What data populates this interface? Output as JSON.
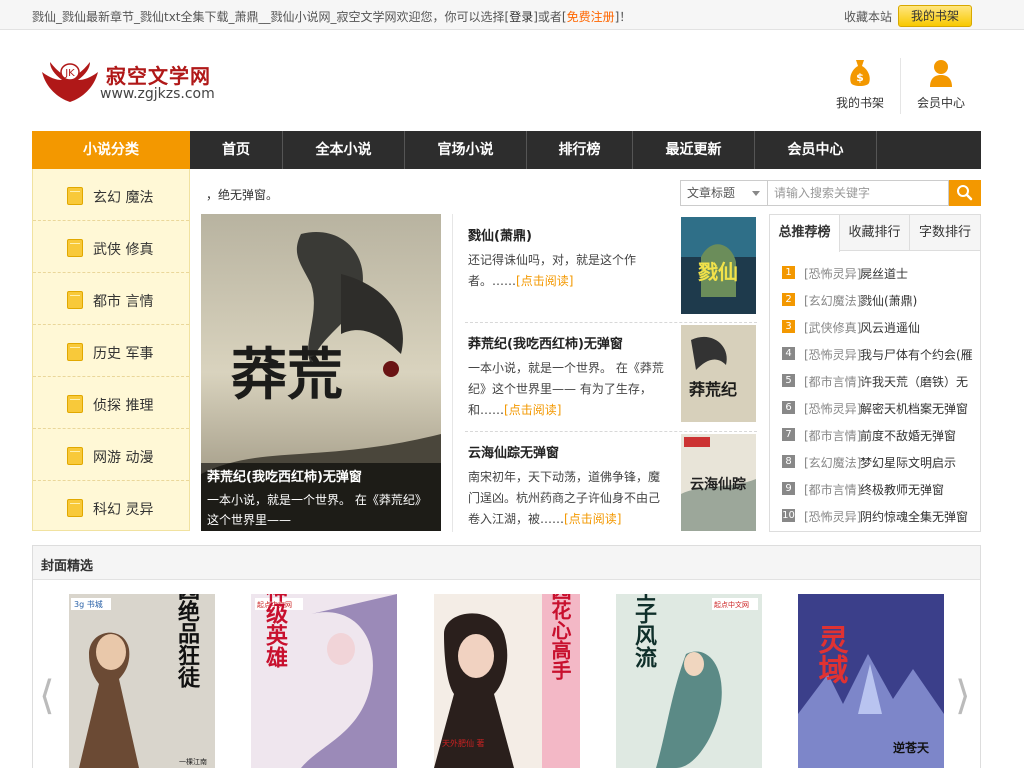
{
  "topbar": {
    "intro_prefix": "戮仙_戮仙最新章节_戮仙txt全集下载_萧鼎__戮仙小说网_寂空文学网欢迎您，你可以选择[",
    "login": "登录",
    "intro_middle": "]或者[",
    "register": "免费注册",
    "intro_suffix": "]！",
    "bookmark": "收藏本站",
    "my_shelf": "我的书架"
  },
  "header": {
    "logo_cn": "寂空文学网",
    "logo_url": "www.zgjkzs.com",
    "logo_badge": "JK",
    "links": [
      {
        "label": "我的书架",
        "icon": "money-bag-icon"
      },
      {
        "label": "会员中心",
        "icon": "user-icon"
      }
    ]
  },
  "nav": {
    "category": "小说分类",
    "items": [
      "首页",
      "全本小说",
      "官场小说",
      "排行榜",
      "最近更新",
      "会员中心"
    ]
  },
  "sidebar": {
    "items": [
      "玄幻 魔法",
      "武侠 修真",
      "都市 言情",
      "历史 军事",
      "侦探 推理",
      "网游 动漫",
      "科幻 灵异"
    ]
  },
  "notice": "，绝无弹窗。",
  "featured": {
    "title": "莽荒纪(我吃西红柿)无弹窗",
    "desc": "一本小说，就是一个世界。 在《莽荒纪》这个世界里——",
    "cover_text": "莽荒"
  },
  "books": [
    {
      "title": "戮仙(萧鼎)",
      "desc": "还记得诛仙吗，对，就是这个作者。……",
      "more": "[点击阅读]",
      "cover_text": "戮仙"
    },
    {
      "title": "莽荒纪(我吃西红柿)无弹窗",
      "desc": "一本小说，就是一个世界。 在《莽荒纪》这个世界里—— 有为了生存，和……",
      "more": "[点击阅读]",
      "cover_text": "莽荒纪"
    },
    {
      "title": "云海仙踪无弹窗",
      "desc": "南宋初年，天下动荡，道佛争锋，魔门逞凶。杭州药商之子许仙身不由己卷入江湖，被……",
      "more": "[点击阅读]",
      "cover_text": "云海仙踪"
    }
  ],
  "search": {
    "type": "文章标题",
    "placeholder": "请输入搜索关键字"
  },
  "ranking": {
    "tabs": [
      "总推荐榜",
      "收藏排行",
      "字数排行"
    ],
    "items": [
      {
        "n": "1",
        "cat": "[恐怖灵异]",
        "name": "屍丝道士"
      },
      {
        "n": "2",
        "cat": "[玄幻魔法]",
        "name": "戮仙(萧鼎)"
      },
      {
        "n": "3",
        "cat": "[武侠修真]",
        "name": "风云逍遥仙"
      },
      {
        "n": "4",
        "cat": "[恐怖灵异]",
        "name": "我与尸体有个约会(雁"
      },
      {
        "n": "5",
        "cat": "[都市言情]",
        "name": "许我天荒（磨铁）无"
      },
      {
        "n": "6",
        "cat": "[恐怖灵异]",
        "name": "解密天机档案无弹窗"
      },
      {
        "n": "7",
        "cat": "[都市言情]",
        "name": "前度不敌婚无弹窗"
      },
      {
        "n": "8",
        "cat": "[玄幻魔法]",
        "name": "梦幻星际文明启示"
      },
      {
        "n": "9",
        "cat": "[都市言情]",
        "name": "终极教师无弹窗"
      },
      {
        "n": "10",
        "cat": "[恐怖灵异]",
        "name": "阴约惊魂全集无弹窗"
      }
    ]
  },
  "showcase": {
    "title": "封面精选",
    "covers": [
      {
        "title": "校园绝品狂徒",
        "brand": "3g 书城",
        "author": "一棵江南"
      },
      {
        "title": "神级英雄",
        "brand": "起点中文网",
        "author": ""
      },
      {
        "title": "校园花心高手",
        "brand": "",
        "author": "天外肥仙 著"
      },
      {
        "title": "士子风流",
        "brand": "起点中文网",
        "author": ""
      },
      {
        "title": "灵域",
        "brand": "",
        "author": "逆苍天"
      }
    ]
  },
  "colors": {
    "accent": "#f39800",
    "nav_bg": "#2d2d2d",
    "sidebar_bg": "#fff8d6"
  }
}
